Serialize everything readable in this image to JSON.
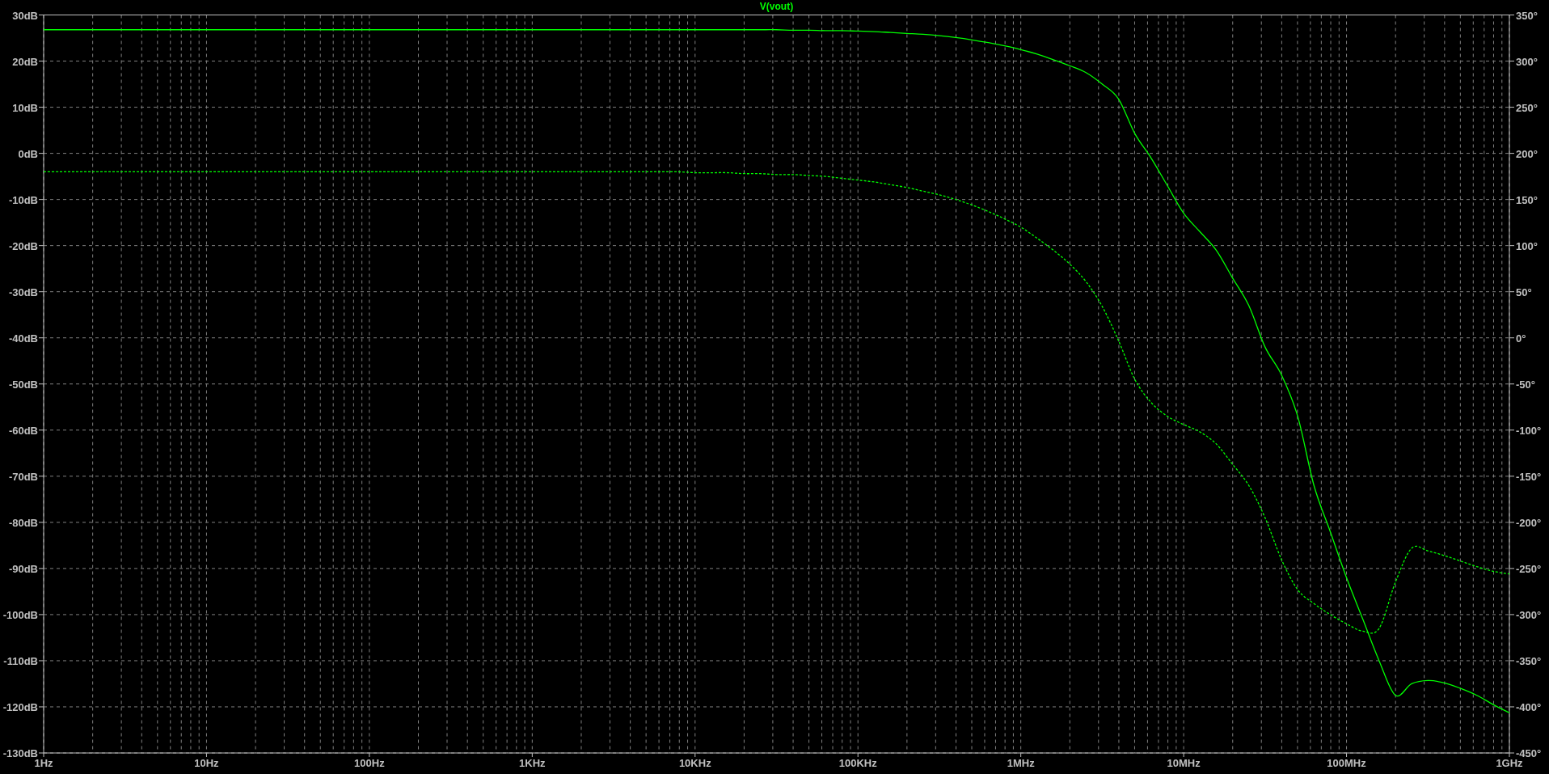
{
  "plot": {
    "title": "V(vout)",
    "magnitude": {
      "chart_data": {
        "type": "line",
        "grid": true,
        "categories": [
          "1Hz",
          null,
          null,
          null,
          null,
          null,
          null,
          null,
          null,
          null,
          "10Hz",
          null,
          null,
          null,
          null,
          null,
          null,
          null,
          null,
          null,
          "100Hz",
          null,
          null,
          null,
          null,
          null,
          null,
          null,
          null,
          null,
          "1KHz",
          null,
          null,
          null,
          null,
          null,
          null,
          null,
          null,
          null,
          "10KHz",
          null,
          null,
          null,
          null,
          null,
          null,
          null,
          null,
          null,
          "100KHz",
          null,
          null,
          null,
          null,
          null,
          null,
          null,
          null,
          null,
          "1MHz",
          null,
          null,
          null,
          null,
          null,
          null,
          null,
          null,
          null,
          "10MHz",
          null,
          null,
          null,
          null,
          null,
          null,
          null,
          null,
          null,
          "100MHz",
          null,
          null,
          null,
          null,
          null,
          null,
          null,
          null,
          null,
          "1GHz"
        ],
        "series": [
          {
            "color": "#00ff00",
            "values": [
              26.8,
              26.8,
              26.8,
              26.8,
              26.8,
              26.8,
              26.8,
              26.8,
              26.8,
              26.8,
              26.8,
              26.8,
              26.8,
              26.8,
              26.8,
              26.8,
              26.8,
              26.8,
              26.8,
              26.8,
              26.8,
              26.8,
              26.8,
              26.8,
              26.8,
              26.8,
              26.8,
              26.8,
              26.8,
              26.8,
              26.8,
              26.8,
              26.8,
              26.8,
              26.8,
              26.8,
              26.8,
              26.8,
              26.8,
              26.8,
              26.8,
              26.8,
              26.8,
              26.8,
              26.8,
              26.8,
              26.7,
              26.7,
              26.6,
              26.6,
              26.5,
              26.4,
              26.2,
              26.0,
              25.8,
              25.5,
              25.1,
              24.6,
              24.0,
              23.3,
              22.5,
              21.5,
              20.3,
              19.0,
              17.5,
              15.0,
              11.8,
              4.3,
              -1,
              -7,
              -13,
              -17,
              -21,
              -27,
              -33,
              -42,
              -48,
              -57,
              -72,
              -82,
              -92,
              -101,
              -110,
              -117.5,
              -115,
              -114.3,
              -114.8,
              -116,
              -117.5,
              -119.5,
              -121.3
            ]
          }
        ],
        "ylim": [
          -130,
          30
        ],
        "yticks": [
          {
            "value": 30,
            "label": "30dB"
          },
          {
            "value": 20,
            "label": "20dB"
          },
          {
            "value": 10,
            "label": "10dB"
          },
          {
            "value": 0,
            "label": "0dB"
          },
          {
            "value": -10,
            "label": "-10dB"
          },
          {
            "value": -20,
            "label": "-20dB"
          },
          {
            "value": -30,
            "label": "-30dB"
          },
          {
            "value": -40,
            "label": "-40dB"
          },
          {
            "value": -50,
            "label": "-50dB"
          },
          {
            "value": -60,
            "label": "-60dB"
          },
          {
            "value": -70,
            "label": "-70dB"
          },
          {
            "value": -80,
            "label": "-80dB"
          },
          {
            "value": -90,
            "label": "-90dB"
          },
          {
            "value": -100,
            "label": "-100dB"
          },
          {
            "value": -110,
            "label": "-110dB"
          },
          {
            "value": -120,
            "label": "-120dB"
          },
          {
            "value": -130,
            "label": "-130dB"
          }
        ]
      }
    },
    "phase": {
      "chart_data": {
        "type": "line",
        "categories": [
          null,
          null,
          null,
          null,
          null,
          null,
          null,
          null,
          null,
          null,
          null,
          null,
          null,
          null,
          null,
          null,
          null,
          null,
          null,
          null,
          null,
          null,
          null,
          null,
          null,
          null,
          null,
          null,
          null,
          null,
          null,
          null,
          null,
          null,
          null,
          null,
          null,
          null,
          null,
          null,
          null,
          null,
          null,
          null,
          null,
          null,
          null,
          null,
          null,
          null,
          null,
          null,
          null,
          null,
          null,
          null,
          null,
          null,
          null,
          null,
          null,
          null,
          null,
          null,
          null,
          null,
          null,
          null,
          null,
          null,
          null,
          null,
          null,
          null,
          null,
          null,
          null,
          null,
          null,
          null,
          null,
          null,
          null,
          null,
          null,
          null,
          null,
          null,
          null,
          null,
          null
        ],
        "series": [
          {
            "color": "#00ff00",
            "line_style": "dashed",
            "values": [
              180,
              180,
              180,
              180,
              180,
              180,
              180,
              180,
              180,
              180,
              180,
              180,
              180,
              180,
              180,
              180,
              180,
              180,
              180,
              180,
              180,
              180,
              180,
              180,
              180,
              180,
              180,
              180,
              180,
              180,
              180,
              180,
              180,
              180,
              180,
              180,
              180,
              180,
              180,
              180,
              179,
              179,
              179,
              178,
              178,
              177,
              177,
              176,
              175,
              173,
              171,
              169,
              166,
              163,
              159,
              155,
              150,
              144,
              137,
              129,
              120,
              108,
              95,
              80,
              61,
              34,
              -3,
              -45,
              -70,
              -85,
              -94,
              -102,
              -115,
              -137,
              -160,
              -195,
              -240,
              -273,
              -288,
              -300,
              -310,
              -318,
              -315,
              -265,
              -228,
              -231,
              -236,
              -242,
              -248,
              -253,
              -256
            ]
          }
        ],
        "ylim": [
          -450,
          350
        ],
        "yticks": [
          {
            "value": 350,
            "label": "350°"
          },
          {
            "value": 300,
            "label": "300°"
          },
          {
            "value": 250,
            "label": "250°"
          },
          {
            "value": 200,
            "label": "200°"
          },
          {
            "value": 150,
            "label": "150°"
          },
          {
            "value": 100,
            "label": "100°"
          },
          {
            "value": 50,
            "label": "50°"
          },
          {
            "value": 0,
            "label": "0°"
          },
          {
            "value": -50,
            "label": "-50°"
          },
          {
            "value": -100,
            "label": "-100°"
          },
          {
            "value": -150,
            "label": "-150°"
          },
          {
            "value": -200,
            "label": "-200°"
          },
          {
            "value": -250,
            "label": "-250°"
          },
          {
            "value": -300,
            "label": "-300°"
          },
          {
            "value": -350,
            "label": "-350°"
          },
          {
            "value": -400,
            "label": "-400°"
          },
          {
            "value": -450,
            "label": "-450°"
          }
        ]
      }
    }
  }
}
